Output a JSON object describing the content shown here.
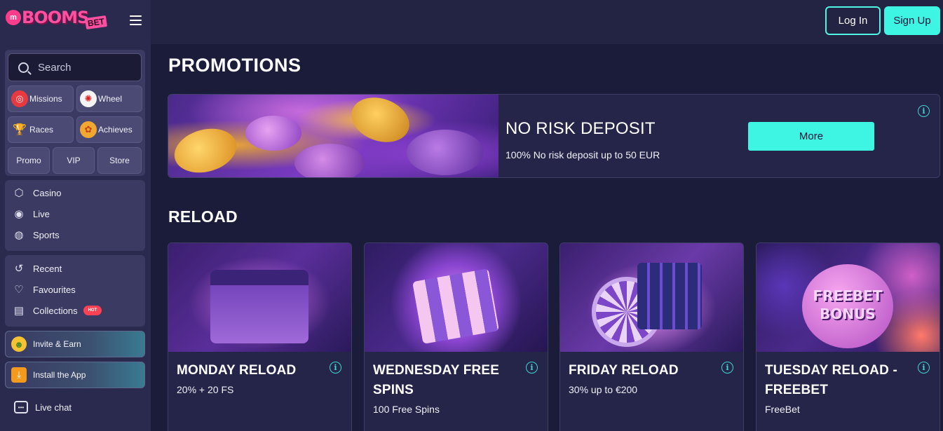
{
  "brand": {
    "name": "BOOMS",
    "suffix": "BET"
  },
  "header": {
    "login_label": "Log In",
    "signup_label": "Sign Up"
  },
  "sidebar": {
    "search_placeholder": "Search",
    "grid": [
      {
        "label": "Missions",
        "icon": "target-icon"
      },
      {
        "label": "Wheel",
        "icon": "wheel-icon"
      },
      {
        "label": "Races",
        "icon": "trophy-icon"
      },
      {
        "label": "Achieves",
        "icon": "medal-icon"
      },
      {
        "label": "Promo"
      },
      {
        "label": "VIP"
      },
      {
        "label": "Store"
      }
    ],
    "nav_main": [
      {
        "label": "Casino",
        "icon": "cube-icon"
      },
      {
        "label": "Live",
        "icon": "live-icon"
      },
      {
        "label": "Sports",
        "icon": "ball-icon"
      }
    ],
    "nav_personal": [
      {
        "label": "Recent",
        "icon": "history-icon"
      },
      {
        "label": "Favourites",
        "icon": "heart-icon"
      },
      {
        "label": "Collections",
        "icon": "collections-icon",
        "badge": "HOT"
      }
    ],
    "invite_label": "Invite & Earn",
    "install_label": "Install the App",
    "chat_label": "Live chat"
  },
  "main": {
    "promotions_heading": "PROMOTIONS",
    "banner": {
      "title": "NO RISK DEPOSIT",
      "description": "100% No risk deposit up to 50 EUR",
      "button_label": "More"
    },
    "reload_heading": "RELOAD",
    "cards": [
      {
        "title": "MONDAY RELOAD",
        "subtitle": "20% + 20 FS"
      },
      {
        "title": "WEDNESDAY FREE SPINS",
        "subtitle": "100 Free Spins"
      },
      {
        "title": "FRIDAY RELOAD",
        "subtitle": "30% up to €200"
      },
      {
        "title": "TUESDAY RELOAD - FREEBET",
        "subtitle": "FreeBet",
        "image_text": "FREEBET BONUS"
      }
    ]
  },
  "colors": {
    "accent": "#3df5e2",
    "background": "#1b1b3a",
    "sidebar": "#2a2a4e",
    "brand": "#ff4fa0",
    "hot": "#ff4154"
  }
}
